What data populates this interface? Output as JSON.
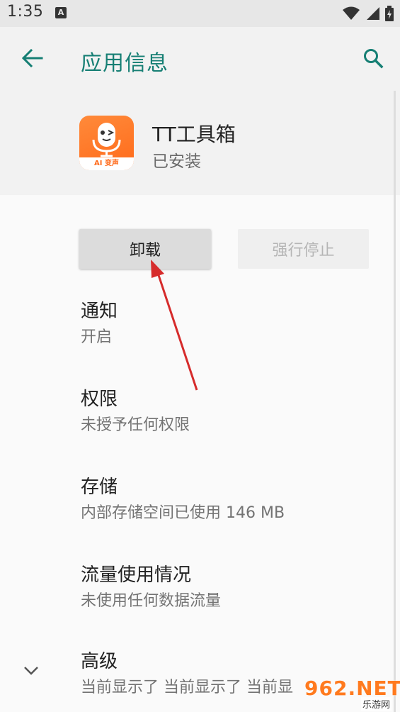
{
  "status_bar": {
    "time": "1:35",
    "notification_letter": "A"
  },
  "app_bar": {
    "title": "应用信息"
  },
  "app": {
    "name": "TT工具箱",
    "status": "已安装",
    "icon_label": "AI 变声"
  },
  "buttons": {
    "uninstall": "卸载",
    "force_stop": "强行停止"
  },
  "items": [
    {
      "title": "通知",
      "subtitle": "开启"
    },
    {
      "title": "权限",
      "subtitle": "未授予任何权限"
    },
    {
      "title": "存储",
      "subtitle": "内部存储空间已使用 146 MB"
    },
    {
      "title": "流量使用情况",
      "subtitle": "未使用任何数据流量"
    },
    {
      "title": "高级",
      "subtitle": "当前显示了 当前显示了 当前显"
    }
  ],
  "watermark": {
    "logo": "962.NET",
    "text": "乐游网"
  },
  "colors": {
    "accent": "#167f74",
    "annotation_arrow": "#d62b2b",
    "app_icon": "#ff6a1a"
  }
}
